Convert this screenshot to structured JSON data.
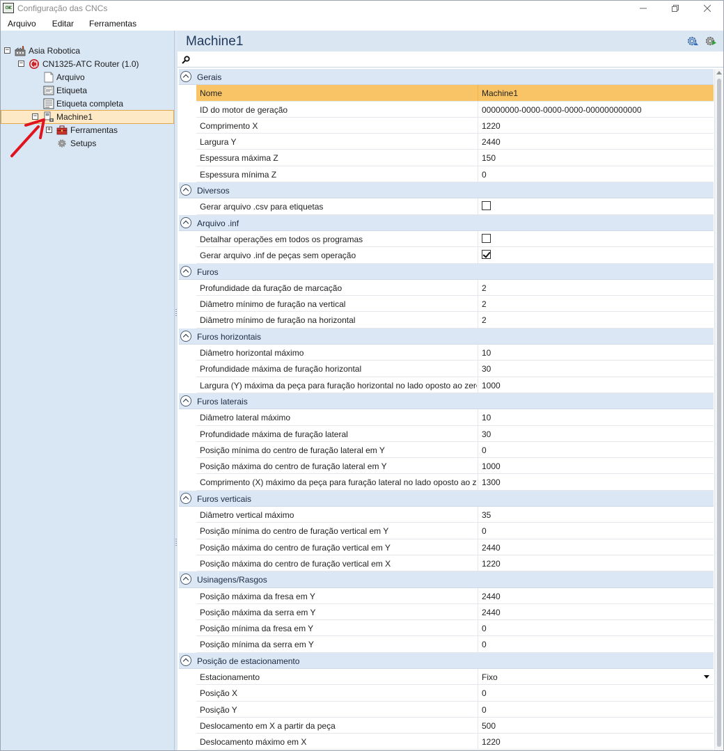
{
  "window": {
    "title": "Configuração das CNCs",
    "app_icon_text": "CNC"
  },
  "menu": [
    "Arquivo",
    "Editar",
    "Ferramentas"
  ],
  "tree": {
    "nodes": [
      {
        "label": "Asia Robotica",
        "icon": "factory-icon",
        "level": 0,
        "expander": "−"
      },
      {
        "label": "CN1325-ATC Router (1.0)",
        "icon": "router-icon",
        "level": 1,
        "expander": "−"
      },
      {
        "label": "Arquivo",
        "icon": "document-icon",
        "level": 2
      },
      {
        "label": "Etiqueta",
        "icon": "label-icon",
        "level": 2
      },
      {
        "label": "Etiqueta completa",
        "icon": "label-full-icon",
        "level": 2
      },
      {
        "label": "Machine1",
        "icon": "machine-icon",
        "level": 2,
        "expander": "−",
        "selected": true
      },
      {
        "label": "Ferramentas",
        "icon": "toolbox-icon",
        "level": 3,
        "expander": "+"
      },
      {
        "label": "Setups",
        "icon": "gear-icon",
        "level": 3
      }
    ]
  },
  "panel": {
    "title": "Machine1",
    "search_placeholder": "",
    "header_buttons": [
      "settings-blue-icon",
      "settings-green-icon"
    ]
  },
  "grid": {
    "categories": [
      {
        "name": "Gerais",
        "props": [
          {
            "name": "Nome",
            "value": "Machine1",
            "selected": true
          },
          {
            "name": "ID do motor de geração",
            "value": "00000000-0000-0000-0000-000000000000"
          },
          {
            "name": "Comprimento X",
            "value": "1220"
          },
          {
            "name": "Largura Y",
            "value": "2440"
          },
          {
            "name": "Espessura máxima Z",
            "value": "150"
          },
          {
            "name": "Espessura mínima Z",
            "value": "0"
          }
        ]
      },
      {
        "name": "Diversos",
        "props": [
          {
            "name": "Gerar arquivo .csv para etiquetas",
            "type": "checkbox",
            "checked": false
          }
        ]
      },
      {
        "name": "Arquivo .inf",
        "props": [
          {
            "name": "Detalhar operações em todos os programas",
            "type": "checkbox",
            "checked": false
          },
          {
            "name": "Gerar arquivo .inf de peças sem operação",
            "type": "checkbox",
            "checked": true
          }
        ]
      },
      {
        "name": "Furos",
        "props": [
          {
            "name": "Profundidade da furação de marcação",
            "value": "2"
          },
          {
            "name": "Diâmetro mínimo de furação na vertical",
            "value": "2"
          },
          {
            "name": "Diâmetro mínimo de furação na horizontal",
            "value": "2"
          }
        ]
      },
      {
        "name": "Furos horizontais",
        "props": [
          {
            "name": "Diâmetro horizontal máximo",
            "value": "10"
          },
          {
            "name": "Profundidade máxima de furação horizontal",
            "value": "30"
          },
          {
            "name": "Largura (Y) máxima da peça para furação horizontal no lado oposto ao zero",
            "value": "1000"
          }
        ]
      },
      {
        "name": "Furos laterais",
        "props": [
          {
            "name": "Diâmetro lateral máximo",
            "value": "10"
          },
          {
            "name": "Profundidade máxima de furação lateral",
            "value": "30"
          },
          {
            "name": "Posição mínima do centro de furação lateral em Y",
            "value": "0"
          },
          {
            "name": "Posição máxima do centro de furação lateral em Y",
            "value": "1000"
          },
          {
            "name": "Comprimento (X) máximo da peça para furação lateral no lado oposto ao zero",
            "value": "1300"
          }
        ]
      },
      {
        "name": "Furos verticais",
        "props": [
          {
            "name": "Diâmetro vertical máximo",
            "value": "35"
          },
          {
            "name": "Posição mínima do centro de furação vertical em Y",
            "value": "0"
          },
          {
            "name": "Posição máxima do centro de furação vertical em Y",
            "value": "2440"
          },
          {
            "name": "Posição máxima do centro de furação vertical em X",
            "value": "1220"
          }
        ]
      },
      {
        "name": "Usinagens/Rasgos",
        "props": [
          {
            "name": "Posição máxima da fresa em Y",
            "value": "2440"
          },
          {
            "name": "Posição máxima da serra em Y",
            "value": "2440"
          },
          {
            "name": "Posição mínima da fresa em Y",
            "value": "0"
          },
          {
            "name": "Posição mínima da serra em Y",
            "value": "0"
          }
        ]
      },
      {
        "name": "Posição de estacionamento",
        "props": [
          {
            "name": "Estacionamento",
            "value": "Fixo",
            "type": "dropdown"
          },
          {
            "name": "Posição X",
            "value": "0"
          },
          {
            "name": "Posição Y",
            "value": "0"
          },
          {
            "name": "Deslocamento em X a partir da peça",
            "value": "500"
          },
          {
            "name": "Deslocamento máximo em X",
            "value": "1220"
          }
        ]
      }
    ]
  },
  "colors": {
    "tree_bg": "#d9e6f4",
    "category_bg": "#dce7f5",
    "selected_row": "#f8c465",
    "selected_tree": "#fde9c6",
    "annotation_arrow": "#e0141e"
  }
}
